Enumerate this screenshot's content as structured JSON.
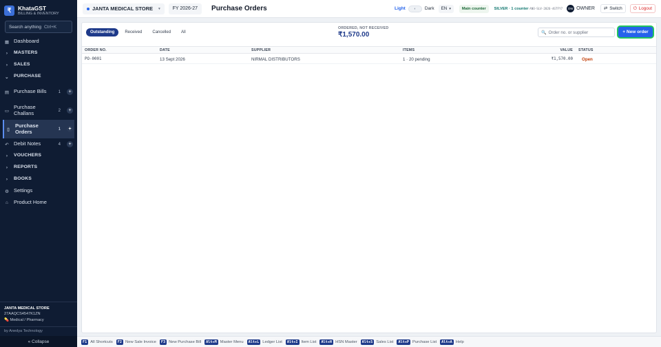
{
  "brand": {
    "title": "KhataGST",
    "subtitle": "BILLING & INVENTORY",
    "logo_glyph": "₹"
  },
  "search": {
    "placeholder": "Search anything",
    "shortcut": "Ctrl+K"
  },
  "nav": [
    {
      "name": "Dashboard",
      "icon": "▦",
      "type": "item"
    },
    {
      "name": "MASTERS",
      "icon": "›",
      "type": "section"
    },
    {
      "name": "SALES",
      "icon": "›",
      "type": "section"
    },
    {
      "name": "PURCHASE",
      "icon": "⌄",
      "type": "section"
    },
    {
      "name": "Purchase Bills",
      "icon": "▤",
      "count": "1",
      "type": "sub"
    },
    {
      "name": "Purchase Challans",
      "icon": "▭",
      "count": "2",
      "type": "sub"
    },
    {
      "name": "Purchase Orders",
      "icon": "▯",
      "count": "1",
      "type": "sub",
      "active": true
    },
    {
      "name": "Debit Notes",
      "icon": "↶",
      "count": "4",
      "type": "sub"
    },
    {
      "name": "VOUCHERS",
      "icon": "›",
      "type": "section"
    },
    {
      "name": "REPORTS",
      "icon": "›",
      "type": "section"
    },
    {
      "name": "BOOKS",
      "icon": "›",
      "type": "section"
    },
    {
      "name": "Settings",
      "icon": "⚙",
      "type": "item"
    },
    {
      "name": "Product Home",
      "icon": "⌂",
      "type": "item"
    }
  ],
  "store_info": {
    "name": "JANTA MEDICAL STORE",
    "gstin": "27AAQCS4547K1ZN",
    "category": "Medical / Pharmacy"
  },
  "byline": "by Anedya Technology",
  "collapse_label": "« Collapse",
  "topbar": {
    "store": "JANTA MEDICAL STORE",
    "fy": "FY 2026-27",
    "page_title": "Purchase Orders",
    "theme_light": "Light",
    "theme_dark": "Dark",
    "lang": "EN",
    "counter": "Main counter",
    "plan": "SILVER · 1 counter",
    "plan_code": "ANO-SLV-2026-4GTFY7",
    "avatar": "OW",
    "user": "OWNER",
    "switch": "Switch",
    "logout": "Logout"
  },
  "filters": [
    {
      "label": "Outstanding",
      "active": true
    },
    {
      "label": "Received",
      "active": false
    },
    {
      "label": "Cancelled",
      "active": false
    },
    {
      "label": "All",
      "active": false
    }
  ],
  "summary": {
    "label": "ORDERED, NOT RECEIVED",
    "value": "₹1,570.00"
  },
  "order_search": {
    "placeholder": "Order no. or supplier"
  },
  "new_order": "+ New order",
  "table": {
    "columns": [
      "ORDER NO.",
      "DATE",
      "SUPPLIER",
      "ITEMS",
      "VALUE",
      "STATUS"
    ],
    "rows": [
      {
        "order": "PO-0001",
        "date": "13 Sept 2026",
        "supplier": "NIRMAL DISTRIBUTORS",
        "items": "1 · 20 pending",
        "value": "₹1,570.00",
        "status": "Open"
      }
    ]
  },
  "shortcuts": [
    {
      "key": "F1",
      "label": "All Shortcuts"
    },
    {
      "key": "F2",
      "label": "New Sale Invoice"
    },
    {
      "key": "F3",
      "label": "New Purchase Bill"
    },
    {
      "key": "Alt+M",
      "label": "Master Menu"
    },
    {
      "key": "Alt+L",
      "label": "Ledger List"
    },
    {
      "key": "Alt+I",
      "label": "Item List"
    },
    {
      "key": "Alt+H",
      "label": "HSN Master"
    },
    {
      "key": "Alt+S",
      "label": "Sales List"
    },
    {
      "key": "Alt+P",
      "label": "Purchase List"
    },
    {
      "key": "Alt+A",
      "label": "Help"
    }
  ],
  "colors": {
    "sidebar_bg": "#0f1c33",
    "accent": "#2563eb",
    "status_open": "#c2410c",
    "highlight": "#22c55e"
  }
}
